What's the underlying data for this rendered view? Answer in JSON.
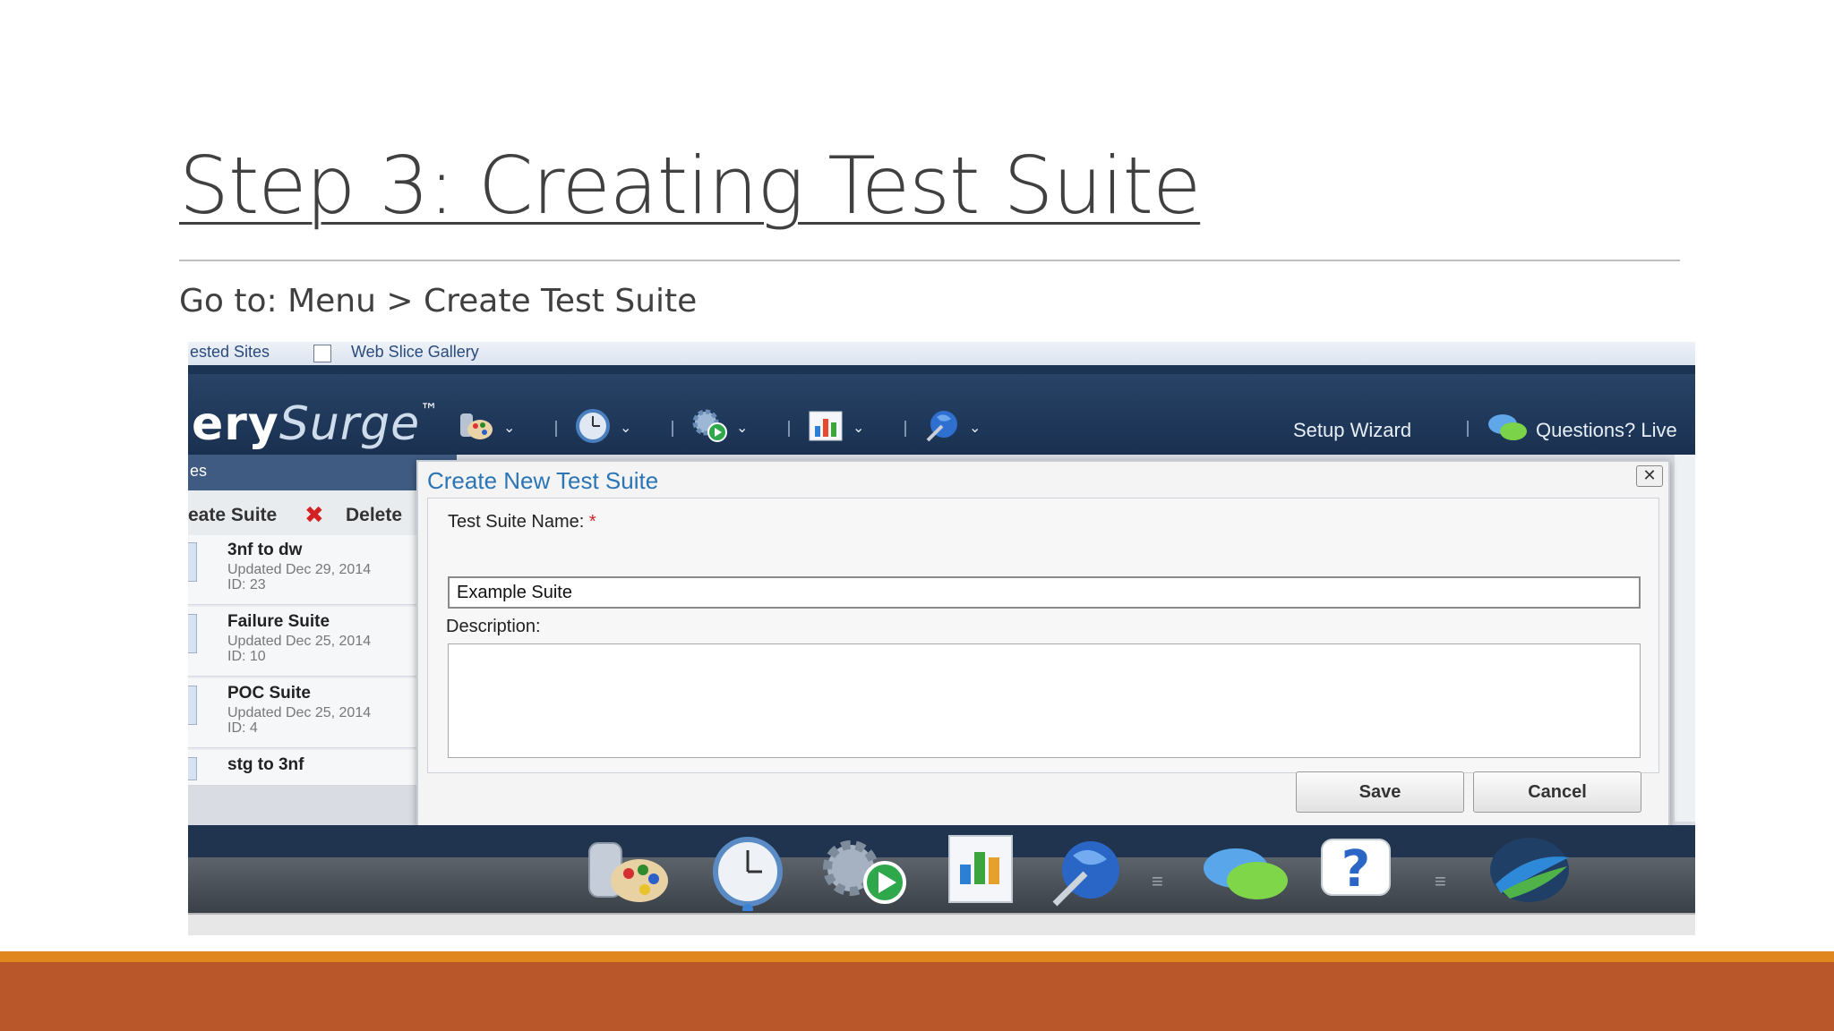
{
  "slide": {
    "title": "Step 3: Creating Test Suite",
    "subtitle": "Go to: Menu > Create Test Suite"
  },
  "browser": {
    "favorites": [
      "ested Sites",
      "Web Slice Gallery"
    ]
  },
  "app": {
    "logo_bold": "ery",
    "logo_italic": "Surge",
    "logo_tm": "™",
    "setup_wizard": "Setup Wizard",
    "questions": "Questions? Live",
    "section_label": "es"
  },
  "sidebar": {
    "create_label": "eate Suite",
    "delete_label": "Delete",
    "items": [
      {
        "name": "3nf to dw",
        "updated": "Updated Dec 29, 2014",
        "id": "ID: 23"
      },
      {
        "name": "Failure Suite",
        "updated": "Updated Dec 25, 2014",
        "id": "ID: 10"
      },
      {
        "name": "POC Suite",
        "updated": "Updated Dec 25, 2014",
        "id": "ID: 4"
      },
      {
        "name": "stg to 3nf",
        "updated": "",
        "id": ""
      }
    ]
  },
  "dialog": {
    "title": "Create New Test Suite",
    "close": "✕",
    "name_label": "Test Suite Name:",
    "required_mark": "*",
    "name_value": "Example Suite",
    "description_label": "Description:",
    "description_value": "",
    "save": "Save",
    "cancel": "Cancel"
  },
  "icons": {
    "toolbar": [
      "palette-db-icon",
      "clock-icon",
      "gear-play-icon",
      "chart-icon",
      "globe-wrench-icon"
    ],
    "dock": [
      "palette-db-icon",
      "clock-icon",
      "gear-play-icon",
      "chart-icon",
      "globe-wrench-icon",
      "chat-bubbles-icon",
      "help-icon",
      "logo-globe-icon"
    ]
  },
  "colors": {
    "accent_orange": "#e0881f",
    "footer": "#b9572b",
    "app_header": "#1f385a",
    "dialog_title": "#2b75b5"
  }
}
